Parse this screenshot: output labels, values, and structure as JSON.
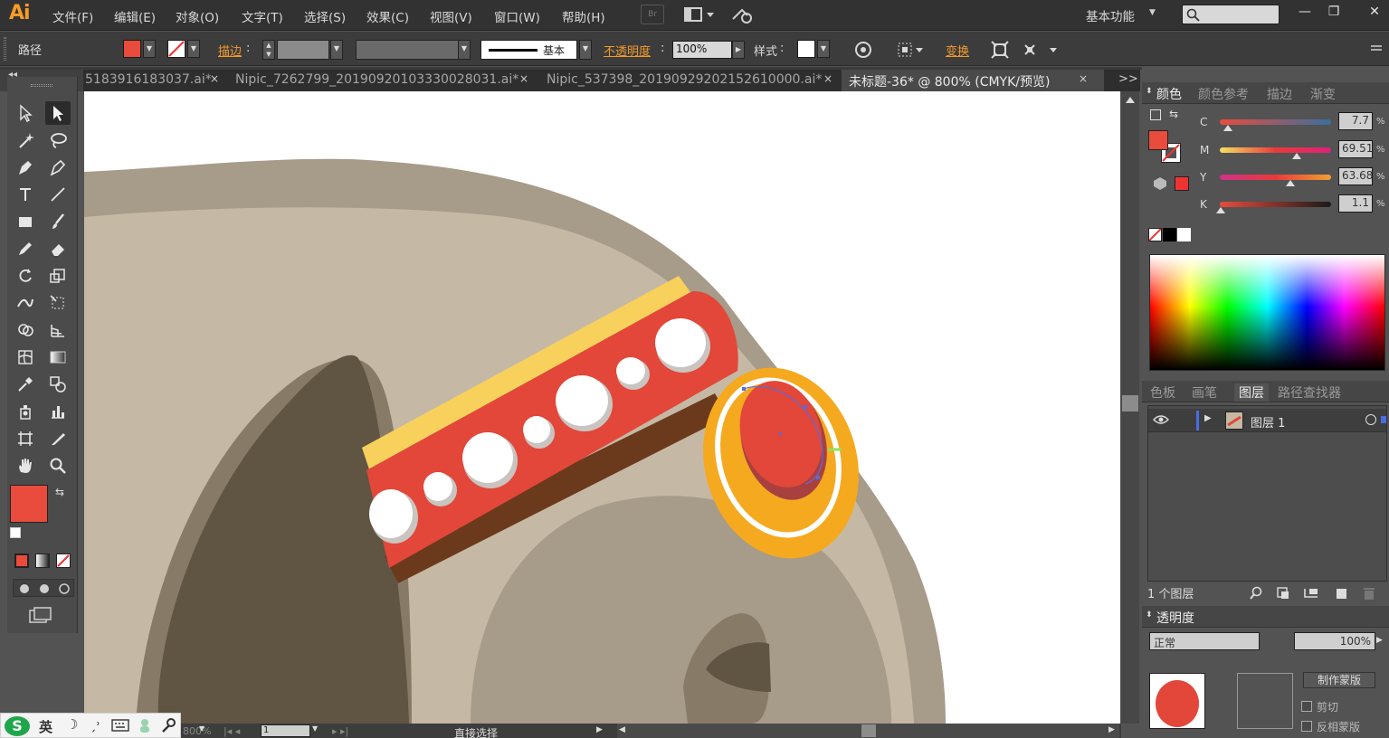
{
  "app": {
    "logo": "Ai",
    "menus": [
      "文件(F)",
      "编辑(E)",
      "对象(O)",
      "文字(T)",
      "选择(S)",
      "效果(C)",
      "视图(V)",
      "窗口(W)",
      "帮助(H)"
    ],
    "bridge_button": "Br",
    "workspace": "基本功能",
    "window_buttons": {
      "minimize": "—",
      "restore": "❐",
      "close": "✕"
    }
  },
  "control_bar": {
    "selection_label": "路径",
    "stroke_label": "描边",
    "stroke_style_label": "基本",
    "opacity_label": "不透明度",
    "opacity_value": "100%",
    "style_label": "样式",
    "transform_label": "变换",
    "fill_color": "#e94b3c"
  },
  "tabs": [
    {
      "label": "5183916183037.ai*",
      "active": false
    },
    {
      "label": "Nipic_7262799_20190920103330028031.ai*",
      "active": false
    },
    {
      "label": "Nipic_537398_20190929202152610000.ai*",
      "active": false
    },
    {
      "label": "未标题-36* @ 800% (CMYK/预览)",
      "active": true
    }
  ],
  "tabs_overflow": ">>",
  "color_panel": {
    "tabs": [
      "颜色",
      "颜色参考",
      "描边",
      "渐变"
    ],
    "channels": [
      {
        "name": "C",
        "value": "7.7",
        "percent": 7.7
      },
      {
        "name": "M",
        "value": "69.51",
        "percent": 69.51
      },
      {
        "name": "Y",
        "value": "63.68",
        "percent": 63.68
      },
      {
        "name": "K",
        "value": "1.1",
        "percent": 1.1
      }
    ],
    "pct_sign": "%"
  },
  "layers_panel": {
    "tabs": [
      "色板",
      "画笔",
      "图层",
      "路径查找器"
    ],
    "layer_name": "图层 1",
    "count_label": "1 个图层"
  },
  "transparency_panel": {
    "title": "透明度",
    "mode": "正常",
    "opacity": "100%",
    "make_mask": "制作蒙版",
    "clip": "剪切",
    "invert_mask": "反相蒙版"
  },
  "status_bar": {
    "zoom": "800%",
    "page": "1",
    "tool": "直接选择"
  },
  "ime": {
    "lang": "英"
  },
  "colors": {
    "accent_orange": "#f39a2c",
    "fill_red": "#e94b3c",
    "camel_light": "#c5b9a5",
    "camel_mid": "#a79b89",
    "camel_dark": "#605443",
    "band_red": "#e2473a",
    "band_yellow": "#f8d15c",
    "band_brown": "#6b3a1c",
    "gem_gold": "#f5a91f"
  }
}
